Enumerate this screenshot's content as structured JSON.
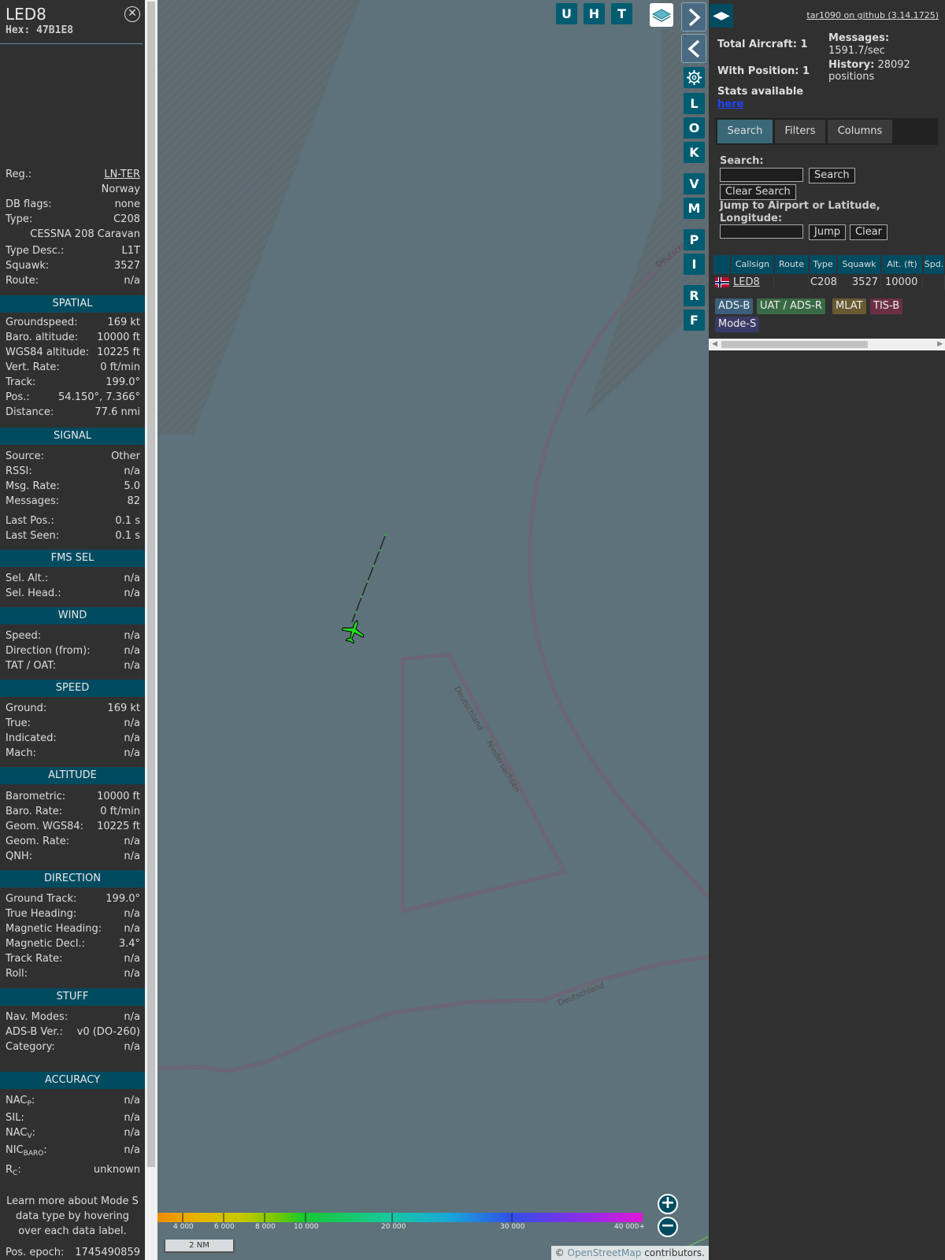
{
  "info": {
    "callsign": "LED8",
    "hex": "Hex: 47B1E8",
    "fields": [
      {
        "k": "Reg.:",
        "v": "LN-TER"
      },
      {
        "k": "",
        "v": "Norway"
      },
      {
        "k": "DB flags:",
        "v": "none"
      },
      {
        "k": "Type:",
        "v": "C208"
      },
      {
        "k": "",
        "v": "CESSNA 208 Caravan"
      },
      {
        "k": "Type Desc.:",
        "v": "L1T"
      },
      {
        "k": "Squawk:",
        "v": "3527"
      },
      {
        "k": "Route:",
        "v": "n/a"
      }
    ],
    "sections": {
      "spatial": "SPATIAL",
      "signal": "SIGNAL",
      "fms": "FMS SEL",
      "wind": "WIND",
      "speed": "SPEED",
      "altitude": "ALTITUDE",
      "direction": "DIRECTION",
      "stuff": "STUFF",
      "accuracy": "ACCURACY"
    },
    "spatial": [
      {
        "k": "Groundspeed:",
        "v": "169 kt"
      },
      {
        "k": "Baro. altitude:",
        "v": "10000 ft"
      },
      {
        "k": "WGS84 altitude:",
        "v": "10225 ft"
      },
      {
        "k": "Vert. Rate:",
        "v": "0 ft/min"
      },
      {
        "k": "Track:",
        "v": "199.0°"
      },
      {
        "k": "Pos.:",
        "v": "54.150°, 7.366°"
      },
      {
        "k": "Distance:",
        "v": "77.6 nmi"
      }
    ],
    "signal": [
      {
        "k": "Source:",
        "v": "Other"
      },
      {
        "k": "RSSI:",
        "v": "n/a"
      },
      {
        "k": "Msg. Rate:",
        "v": "5.0"
      },
      {
        "k": "Messages:",
        "v": "82"
      },
      {
        "k": "Last Pos.:",
        "v": "0.1 s"
      },
      {
        "k": "Last Seen:",
        "v": "0.1 s"
      }
    ],
    "fms": [
      {
        "k": "Sel. Alt.:",
        "v": "n/a"
      },
      {
        "k": "Sel. Head.:",
        "v": "n/a"
      }
    ],
    "wind": [
      {
        "k": "Speed:",
        "v": "n/a"
      },
      {
        "k": "Direction (from):",
        "v": "n/a"
      },
      {
        "k": "TAT / OAT:",
        "v": "n/a"
      }
    ],
    "speed": [
      {
        "k": "Ground:",
        "v": "169 kt"
      },
      {
        "k": "True:",
        "v": "n/a"
      },
      {
        "k": "Indicated:",
        "v": "n/a"
      },
      {
        "k": "Mach:",
        "v": "n/a"
      }
    ],
    "altitude": [
      {
        "k": "Barometric:",
        "v": "10000 ft"
      },
      {
        "k": "Baro. Rate:",
        "v": "0 ft/min"
      },
      {
        "k": "Geom. WGS84:",
        "v": "10225 ft"
      },
      {
        "k": "Geom. Rate:",
        "v": "n/a"
      },
      {
        "k": "QNH:",
        "v": "n/a"
      }
    ],
    "direction": [
      {
        "k": "Ground Track:",
        "v": "199.0°"
      },
      {
        "k": "True Heading:",
        "v": "n/a"
      },
      {
        "k": "Magnetic Heading:",
        "v": "n/a"
      },
      {
        "k": "Magnetic Decl.:",
        "v": "3.4°"
      },
      {
        "k": "Track Rate:",
        "v": "n/a"
      },
      {
        "k": "Roll:",
        "v": "n/a"
      }
    ],
    "stuff": [
      {
        "k": "Nav. Modes:",
        "v": "n/a"
      },
      {
        "k": "ADS-B Ver.:",
        "v": "v0 (DO-260)"
      },
      {
        "k": "Category:",
        "v": "n/a"
      }
    ],
    "accuracy": {
      "nacp_k": "NAC",
      "nacp_sub": "P",
      "nacp_v": "n/a",
      "sil_k": "SIL:",
      "sil_v": "n/a",
      "nacv_k": "NAC",
      "nacv_sub": "V",
      "nacv_v": "n/a",
      "nicbaro_k": "NIC",
      "nicbaro_sub": "BARO",
      "nicbaro_v": "n/a",
      "rc_k": "R",
      "rc_sub": "C",
      "rc_v": "unknown"
    },
    "note": "Learn more about Mode S data type by hovering over each data label.",
    "epoch_k": "Pos. epoch:",
    "epoch_v": "1745490859"
  },
  "map": {
    "buttons": {
      "u": "U",
      "h": "H",
      "t": "T",
      "l": "L",
      "o": "O",
      "k": "K",
      "v": "V",
      "m": "M",
      "p": "P",
      "i": "I",
      "r": "R",
      "f": "F"
    },
    "border_labels": [
      "Deutschland",
      "Niedersachsen",
      "Deutschland",
      "Deutschl"
    ],
    "scale": "2 NM",
    "attrib_prefix": "© ",
    "attrib_osm": "OpenStreetMap",
    "attrib_suffix": " contributors.",
    "colorbar_labels": [
      "4 000",
      "6 000",
      "8 000",
      "10 000",
      "20 000",
      "30 000",
      "40 000+"
    ],
    "aircraft_color": "#22dd22"
  },
  "right": {
    "github": "tar1090 on github (3.14.1725)",
    "total_aircraft": "Total Aircraft: 1",
    "with_position": "With Position: 1",
    "stats_prefix": "Stats available",
    "stats_link": "here",
    "messages_label": "Messages:",
    "messages_value": "1591.7/sec",
    "history_label": "History:",
    "history_value": "28092 positions",
    "tabs": [
      "Search",
      "Filters",
      "Columns"
    ],
    "search_label": "Search:",
    "search_button": "Search",
    "clear_search_button": "Clear Search",
    "jump_label": "Jump to Airport or Latitude, Longitude:",
    "jump_button": "Jump",
    "clear_button": "Clear",
    "table": {
      "headers": [
        "",
        "Callsign",
        "Route",
        "Type",
        "Squawk",
        "Alt. (ft)",
        "Spd."
      ],
      "row": {
        "callsign": "LED8",
        "route": "",
        "type": "C208",
        "squawk": "3527",
        "alt": "10000",
        "spd": ""
      }
    },
    "sources": [
      {
        "label": "ADS-B",
        "color": "#3b5f7a"
      },
      {
        "label": "UAT / ADS-R",
        "color": "#3a6a44"
      },
      {
        "label": "MLAT",
        "color": "#6a5a33"
      },
      {
        "label": "TIS-B",
        "color": "#6a2f44"
      },
      {
        "label": "Mode-S",
        "color": "#3a3a66"
      }
    ]
  }
}
